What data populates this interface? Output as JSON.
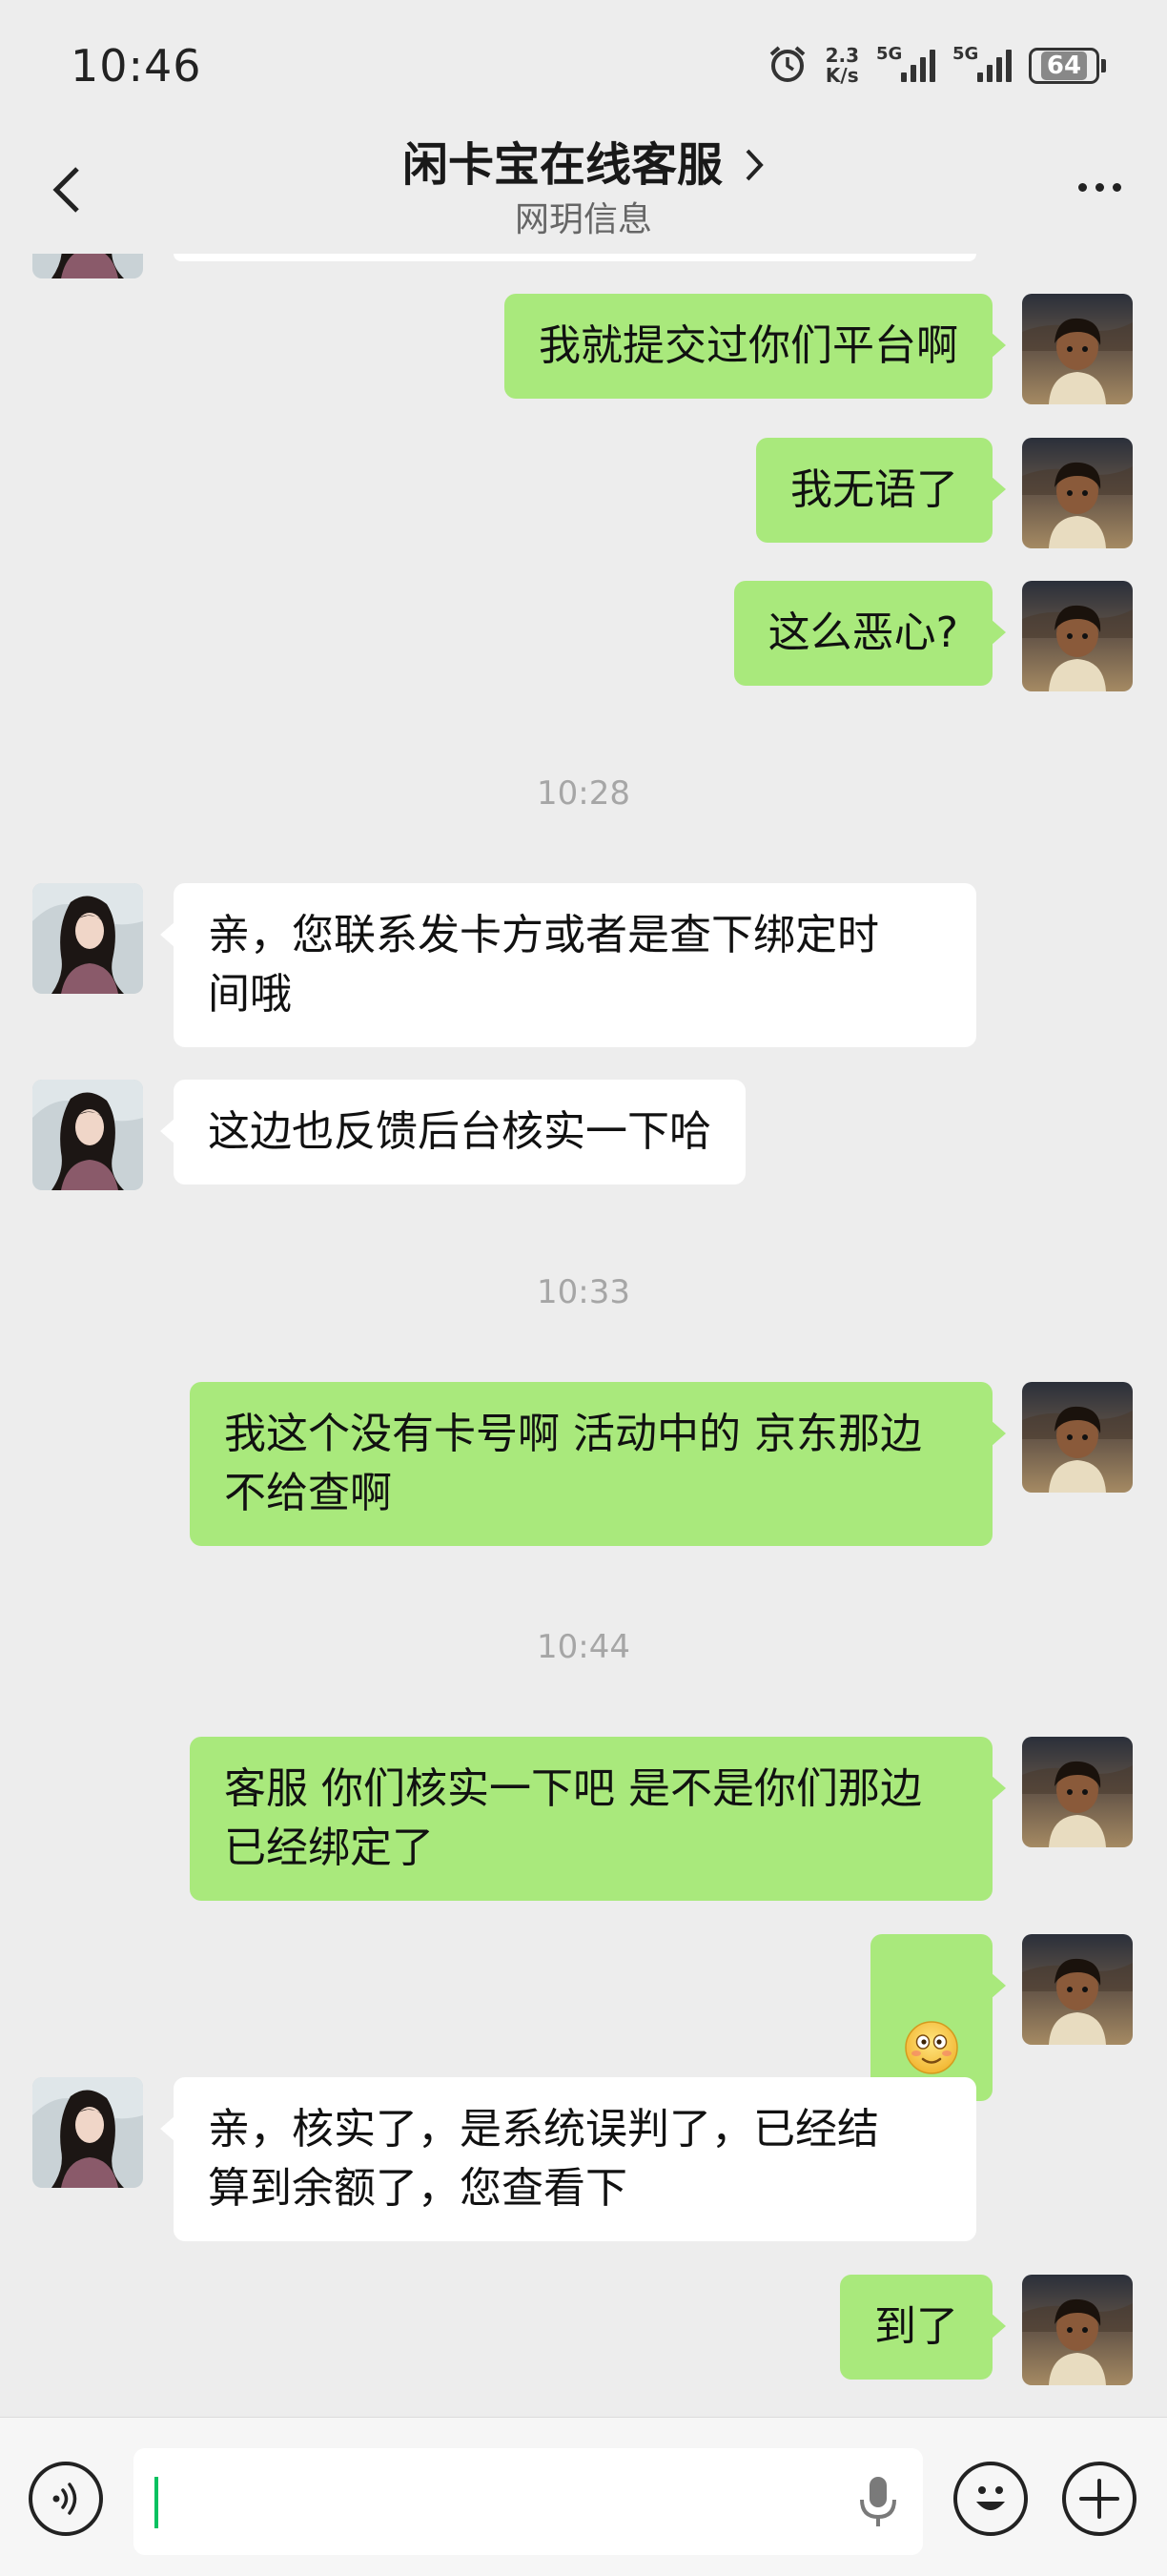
{
  "status_bar": {
    "time": "10:46",
    "net_speed_value": "2.3",
    "net_speed_unit": "K/s",
    "signal1_label": "5G",
    "signal2_label": "5G",
    "battery": "64"
  },
  "header": {
    "title": "闲卡宝在线客服",
    "subtitle": "网玥信息"
  },
  "messages": [
    {
      "sender": "me",
      "text": "我就提交过你们平台啊"
    },
    {
      "sender": "me",
      "text": "我无语了"
    },
    {
      "sender": "me",
      "text": "这么恶心?"
    },
    {
      "type": "time",
      "text": "10:28"
    },
    {
      "sender": "them",
      "text": "亲，您联系发卡方或者是查下绑定时\n间哦"
    },
    {
      "sender": "them",
      "text": "这边也反馈后台核实一下哈"
    },
    {
      "type": "time",
      "text": "10:33"
    },
    {
      "sender": "me",
      "text": "我这个没有卡号啊 活动中的 京东那边\n不给查啊"
    },
    {
      "type": "time",
      "text": "10:44"
    },
    {
      "sender": "me",
      "text": "客服 你们核实一下吧 是不是你们那边\n已经绑定了"
    },
    {
      "sender": "me",
      "emoji": "awkward-smile-emoji"
    },
    {
      "sender": "them",
      "text": "亲，核实了，是系统误判了，已经结\n算到余额了，您查看下"
    },
    {
      "sender": "me",
      "text": "到了"
    }
  ],
  "input": {
    "value": "",
    "caret_color": "#07c160"
  },
  "colors": {
    "my_bubble": "#a9e97c",
    "their_bubble": "#ffffff",
    "background": "#ededed"
  }
}
